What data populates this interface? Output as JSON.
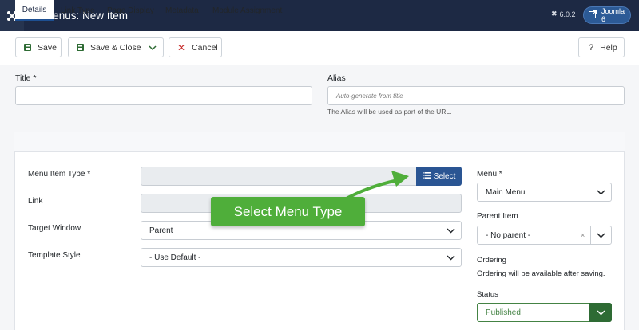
{
  "header": {
    "title": "Menus: New Item",
    "version": "6.0.2",
    "site_label": "Joomla 6"
  },
  "toolbar": {
    "save": "Save",
    "save_close": "Save & Close",
    "cancel": "Cancel",
    "help": "Help"
  },
  "title_field": {
    "label": "Title *",
    "value": ""
  },
  "alias_field": {
    "label": "Alias",
    "placeholder": "Auto-generate from title",
    "help": "The Alias will be used as part of the URL."
  },
  "tabs": [
    "Details",
    "Link Type",
    "Page Display",
    "Metadata",
    "Module Assignment"
  ],
  "details": {
    "menu_item_type_label": "Menu Item Type *",
    "select_label": "Select",
    "link_label": "Link",
    "target_window_label": "Target Window",
    "target_window_value": "Parent",
    "template_style_label": "Template Style",
    "template_style_value": "- Use Default -"
  },
  "side": {
    "menu_label": "Menu *",
    "menu_value": "Main Menu",
    "parent_label": "Parent Item",
    "parent_value": "- No parent -",
    "parent_clear": "×",
    "ordering_label": "Ordering",
    "ordering_note": "Ordering will be available after saving.",
    "status_label": "Status",
    "status_value": "Published"
  },
  "callout": {
    "text": "Select Menu Type"
  },
  "colors": {
    "header_bg": "#1d2944",
    "primary": "#2a5593",
    "callout": "#4fae3a",
    "status": "#2e6b34"
  }
}
